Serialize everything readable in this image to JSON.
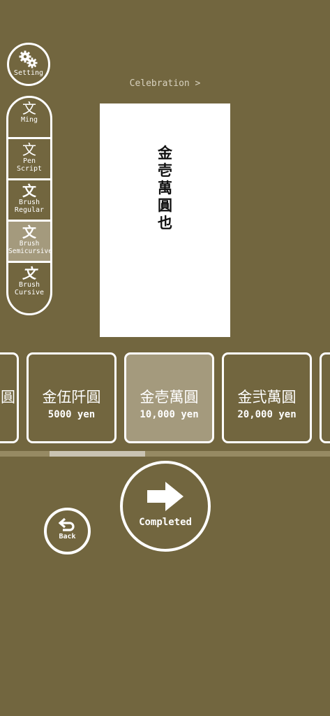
{
  "toolbar": {
    "setting_label": "Setting"
  },
  "font_styles": [
    {
      "glyph": "文",
      "label": "Ming",
      "selected": false
    },
    {
      "glyph": "文",
      "label": "Pen Script",
      "selected": false
    },
    {
      "glyph": "文",
      "label": "Brush Regular",
      "selected": false
    },
    {
      "glyph": "文",
      "label": "Brush Semicursive",
      "selected": true
    },
    {
      "glyph": "文",
      "label": "Brush Cursive",
      "selected": false
    }
  ],
  "category": {
    "label": "Celebration >"
  },
  "envelope": {
    "characters": [
      "金",
      "壱",
      "萬",
      "圓",
      "也"
    ]
  },
  "amounts": [
    {
      "kanji": "圓",
      "yen": ""
    },
    {
      "kanji": "金伍阡圓",
      "yen": "5000 yen"
    },
    {
      "kanji": "金壱萬圓",
      "yen": "10,000 yen"
    },
    {
      "kanji": "金弐萬圓",
      "yen": "20,000 yen"
    }
  ],
  "selected_amount_index": 2,
  "scroll": {
    "position_fraction": 0.15,
    "visible_fraction": 0.29
  },
  "actions": {
    "completed_label": "Completed",
    "back_label": "Back"
  },
  "colors": {
    "background": "#72663f",
    "selected": "#a49a7d",
    "foreground": "#ffffff"
  }
}
